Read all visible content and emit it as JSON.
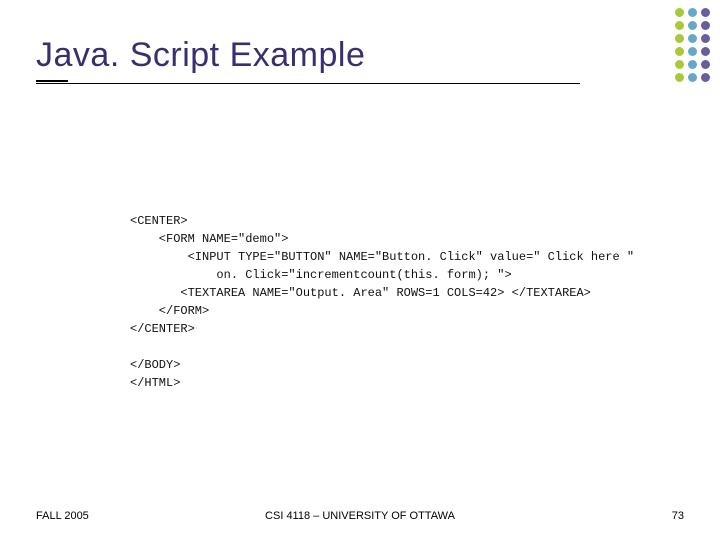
{
  "header": {
    "title": "Java. Script Example"
  },
  "decor": {
    "colA": "#a9c938",
    "colB": "#67a8c7",
    "colC": "#6b5d9c",
    "rows": 6
  },
  "code": {
    "lines": [
      "<CENTER>",
      "    <FORM NAME=\"demo\">",
      "        <INPUT TYPE=\"BUTTON\" NAME=\"Button. Click\" value=\" Click here \"",
      "            on. Click=\"incrementcount(this. form); \">",
      "       <TEXTAREA NAME=\"Output. Area\" ROWS=1 COLS=42> </TEXTAREA>",
      "    </FORM>",
      "</CENTER>",
      "",
      "</BODY>",
      "</HTML>"
    ]
  },
  "footer": {
    "left": "FALL 2005",
    "center": "CSI 4118 – UNIVERSITY OF OTTAWA",
    "right": "73"
  }
}
